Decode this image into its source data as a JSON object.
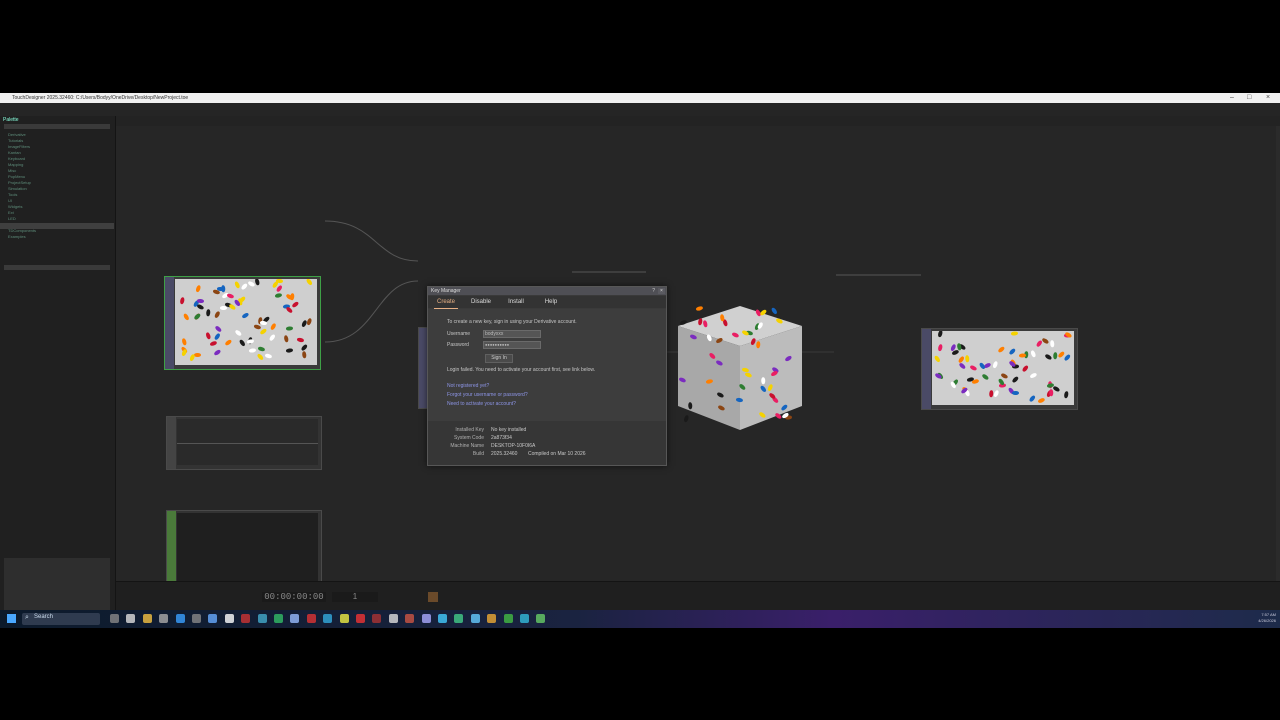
{
  "window": {
    "title": "TouchDesigner 2025.32460: C:/Users/Bodyy/OneDrive/Desktop/NewProject.toe"
  },
  "palette": {
    "header": "Palette",
    "items": [
      "Derivative",
      "Tutorials",
      "ImageFilters",
      "Kantan",
      "Keyboard",
      "Mapping",
      "Misc",
      "PopMenu",
      "ProjectSetup",
      "Simulation",
      "Tools",
      "UI",
      "Widgets",
      "Ext",
      "LED",
      "Techniques",
      "TDComponents",
      "Examples"
    ]
  },
  "timeline": {
    "timecode": "00:00:00:00",
    "frame": "1"
  },
  "dialog": {
    "title": "Key Manager",
    "help": "?",
    "close": "×",
    "tabs": [
      "Create",
      "Disable",
      "Install",
      "Help"
    ],
    "intro": "To create a new key, sign in using your Derivative account.",
    "username_label": "Username",
    "username_value": "bodyxxx",
    "password_label": "Password",
    "password_value": "●●●●●●●●●●",
    "signin_label": "Sign In",
    "error": "Login failed. You need to activate your account first, see link below.",
    "links": [
      "Not registered yet?",
      "Forgot your username or password?",
      "Need to activate your account?"
    ],
    "info": {
      "installed_key_label": "Installed Key",
      "installed_key_value": "No key installed",
      "system_code_label": "System Code",
      "system_code_value": "2a873f34",
      "machine_name_label": "Machine Name",
      "machine_name_value": "DESKTOP-10F0I6A",
      "build_label": "Build",
      "build_value": "2025.32460",
      "compiled_value": "Compiled on Mar 10 2026"
    }
  },
  "taskbar": {
    "search_label": "Search",
    "time": "7:57 AM",
    "date": "4/26/2026"
  },
  "colors": {
    "accent_tab": "#e6b085",
    "link": "#8d95e6",
    "node_selected": "#3ea046",
    "node_green": "#4a7a3a"
  }
}
